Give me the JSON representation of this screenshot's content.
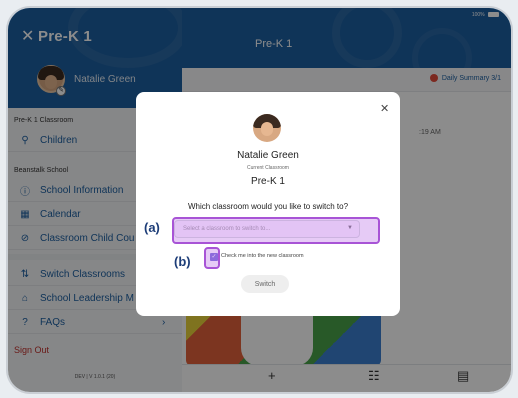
{
  "sidebar": {
    "title": "Pre-K 1",
    "close_icon": "close-icon",
    "user_name": "Natalie Green",
    "section1": "Pre-K 1 Classroom",
    "section2": "Beanstalk School",
    "items": [
      {
        "label": "Children",
        "icon": "person-icon"
      },
      {
        "label": "School Information",
        "icon": "info-icon"
      },
      {
        "label": "Calendar",
        "icon": "calendar-icon"
      },
      {
        "label": "Classroom Child Cou",
        "icon": "check-circle-icon"
      },
      {
        "label": "Switch Classrooms",
        "icon": "switch-icon"
      },
      {
        "label": "School Leadership M",
        "icon": "building-icon"
      },
      {
        "label": "FAQs",
        "icon": "help-icon"
      }
    ],
    "sign_out": "Sign Out",
    "version": "DEV | V 1.0.1 (20)"
  },
  "main": {
    "title": "Pre-K 1",
    "status": "100%",
    "daily_summary": "Daily Summary 3/1",
    "feed_time": ":19 AM"
  },
  "bottom_nav": {
    "icons": [
      "plus-icon",
      "chat-icon",
      "clipboard-icon"
    ],
    "glyphs": [
      "+",
      "☷",
      "▤"
    ]
  },
  "modal": {
    "name": "Natalie Green",
    "current_label": "Current Classroom",
    "current_class": "Pre-K 1",
    "question": "Which classroom would you like to switch to?",
    "select_placeholder": "Select a classroom to switch to...",
    "checkbox_label": "Check me into the new classroom",
    "checkbox_checked": true,
    "switch_button": "Switch"
  },
  "annotations": {
    "a": "(a)",
    "b": "(b)",
    "color": "#a854d6"
  },
  "colors": {
    "brand": "#1d5fa0",
    "sign_out": "#c0302c",
    "checkbox": "#5b4fcf"
  }
}
